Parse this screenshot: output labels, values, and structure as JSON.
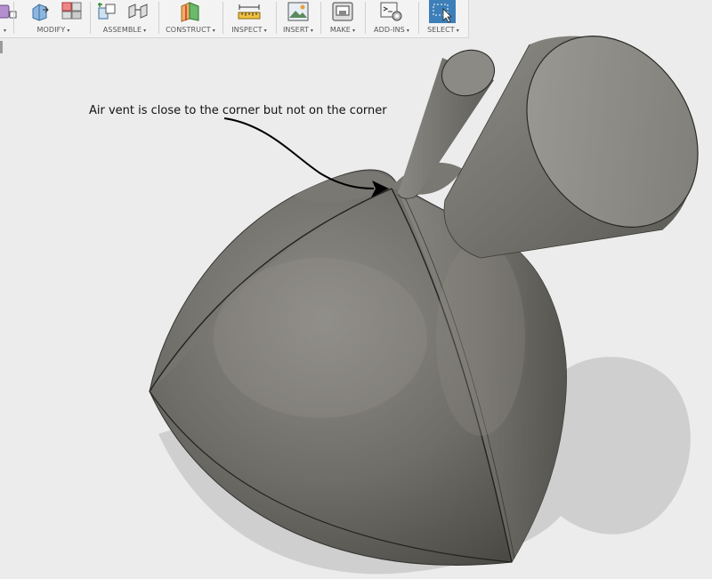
{
  "toolbar": {
    "groups": [
      {
        "label": "",
        "icon": "create-icon"
      },
      {
        "label": "MODIFY",
        "icon": "modify-icon"
      },
      {
        "label": "ASSEMBLE",
        "icon": "assemble-icon"
      },
      {
        "label": "CONSTRUCT",
        "icon": "construct-icon"
      },
      {
        "label": "INSPECT",
        "icon": "inspect-icon"
      },
      {
        "label": "INSERT",
        "icon": "insert-icon"
      },
      {
        "label": "MAKE",
        "icon": "make-icon"
      },
      {
        "label": "ADD-INS",
        "icon": "add-ins-icon"
      },
      {
        "label": "SELECT",
        "icon": "select-icon"
      }
    ],
    "caret": "▾"
  },
  "annotation": {
    "text": "Air vent is close to the corner but not on the corner"
  },
  "colors": {
    "body": "#6f6d67",
    "shadow": "#cfcfcf",
    "background": "#ececec",
    "select_accent": "#3d7fb8"
  }
}
